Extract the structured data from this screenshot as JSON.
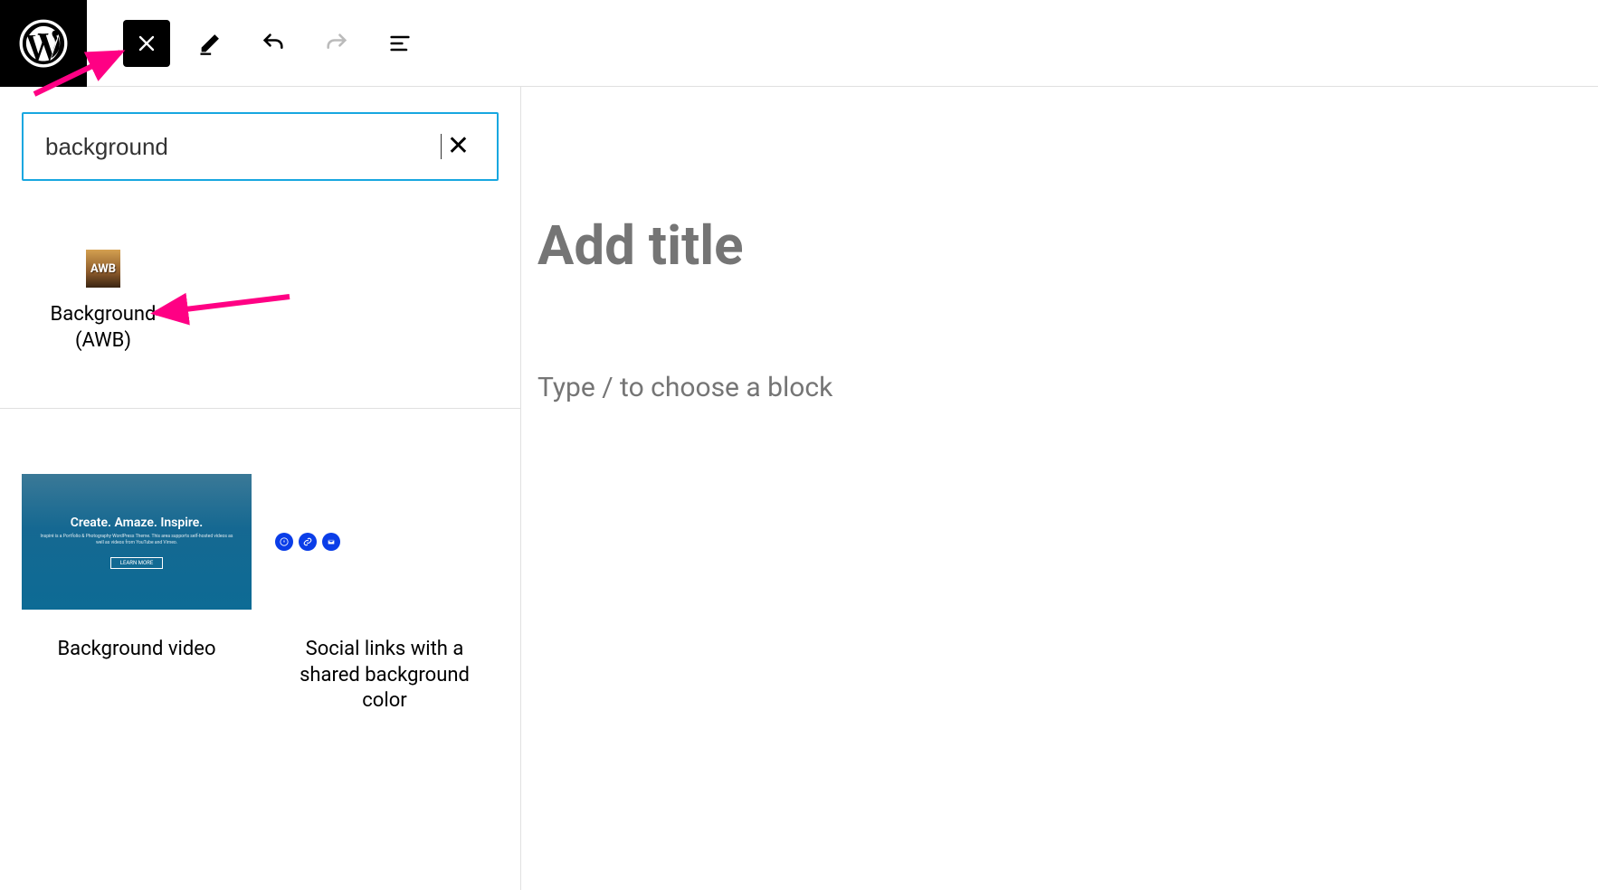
{
  "header": {
    "logo": "wordpress"
  },
  "search": {
    "value": "background"
  },
  "results": {
    "blocks": [
      {
        "icon_text": "AWB",
        "label_line1": "Background",
        "label_line2": "(AWB)"
      }
    ]
  },
  "patterns": [
    {
      "preview_title": "Create. Amaze. Inspire.",
      "preview_subtitle": "Inspiré is a Portfolio & Photography WordPress Theme. This area supports self-hosted videos as well as videos from YouTube and Vimeo.",
      "preview_button": "LEARN MORE",
      "label": "Background video"
    },
    {
      "label": "Social links with a shared background color"
    }
  ],
  "editor": {
    "title_placeholder": "Add title",
    "block_placeholder": "Type / to choose a block"
  }
}
